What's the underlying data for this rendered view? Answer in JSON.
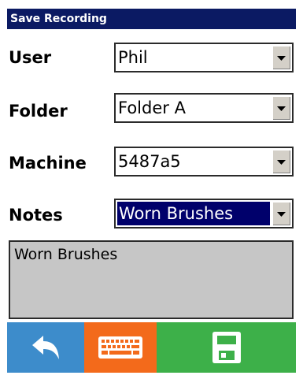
{
  "dialog": {
    "title": "Save Recording"
  },
  "fields": {
    "user": {
      "label": "User",
      "value": "Phil"
    },
    "folder": {
      "label": "Folder",
      "value": "Folder A"
    },
    "machine": {
      "label": "Machine",
      "value": "5487a5"
    },
    "notes": {
      "label": "Notes",
      "value": "Worn Brushes"
    }
  },
  "notes_text": "Worn Brushes",
  "toolbar": {
    "buttons": [
      {
        "icon": "back-arrow-icon",
        "color": "#3d8ccb"
      },
      {
        "icon": "keyboard-icon",
        "color": "#f36a1b"
      },
      {
        "icon": "floppy-disk-icon",
        "color": "#3db049"
      }
    ]
  },
  "colors": {
    "titlebar": "#0b1a63",
    "selection": "#00006b",
    "notes_background": "#c6c6c6"
  }
}
